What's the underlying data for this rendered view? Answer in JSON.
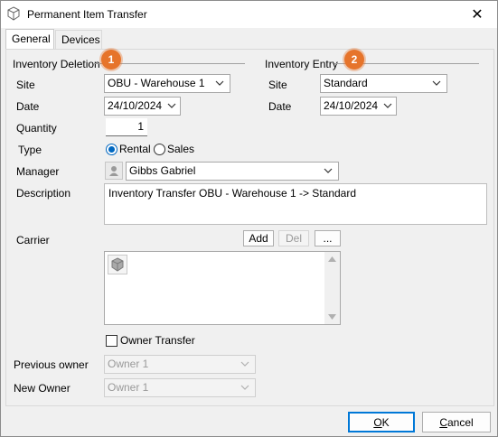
{
  "window": {
    "title": "Permanent Item Transfer",
    "close_glyph": "✕"
  },
  "tabs": [
    {
      "label": "General",
      "active": true
    },
    {
      "label": "Devices",
      "active": false
    }
  ],
  "deletion": {
    "section_label": "Inventory Deletion",
    "badge": "1",
    "site_label": "Site",
    "site_value": "OBU - Warehouse 1",
    "date_label": "Date",
    "date_value": "24/10/2024",
    "quantity_label": "Quantity",
    "quantity_value": "1",
    "type_label": "Type",
    "type_options": [
      "Rental",
      "Sales"
    ],
    "type_selected": "Rental",
    "manager_label": "Manager",
    "manager_value": "Gibbs Gabriel",
    "description_label": "Description",
    "description_value": "Inventory Transfer OBU - Warehouse 1 -> Standard",
    "carrier_label": "Carrier",
    "carrier_buttons": {
      "add": "Add",
      "del": "Del",
      "more": "..."
    },
    "owner_transfer_label": "Owner Transfer",
    "previous_owner_label": "Previous owner",
    "previous_owner_value": "Owner 1",
    "new_owner_label": "New Owner",
    "new_owner_value": "Owner 1"
  },
  "entry": {
    "section_label": "Inventory Entry",
    "badge": "2",
    "site_label": "Site",
    "site_value": "Standard",
    "date_label": "Date",
    "date_value": "24/10/2024"
  },
  "footer": {
    "ok_accel": "O",
    "ok_rest": "K",
    "cancel_accel": "C",
    "cancel_rest": "ancel"
  },
  "colors": {
    "badge": "#e6742b",
    "accent": "#0067c0",
    "focus": "#0078d7"
  }
}
